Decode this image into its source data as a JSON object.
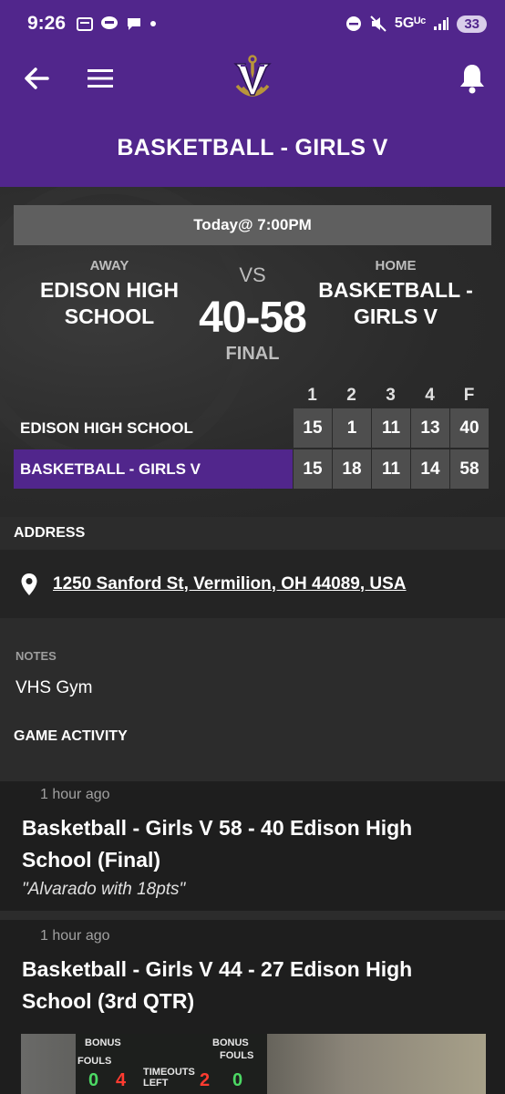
{
  "status_bar": {
    "time": "9:26",
    "network": "5Gᵁᶜ",
    "battery": "33"
  },
  "app_bar": {
    "title": "BASKETBALL - GIRLS V"
  },
  "game": {
    "date_time": "Today@ 7:00PM",
    "away": {
      "side_label": "AWAY",
      "team": "EDISON HIGH SCHOOL"
    },
    "home": {
      "side_label": "HOME",
      "team": "BASKETBALL - GIRLS V"
    },
    "vs": "VS",
    "score": "40-58",
    "status": "FINAL",
    "linescore": {
      "headers": [
        "1",
        "2",
        "3",
        "4",
        "F"
      ],
      "rows": [
        {
          "team": "EDISON HIGH SCHOOL",
          "scores": [
            "15",
            "1",
            "11",
            "13",
            "40"
          ]
        },
        {
          "team": "BASKETBALL - GIRLS V",
          "scores": [
            "15",
            "18",
            "11",
            "14",
            "58"
          ]
        }
      ]
    }
  },
  "address": {
    "header": "ADDRESS",
    "text": "1250 Sanford St, Vermilion, OH 44089, USA"
  },
  "notes": {
    "label": "NOTES",
    "value": "VHS Gym"
  },
  "activity": {
    "header": "GAME ACTIVITY",
    "items": [
      {
        "time": "1 hour ago",
        "title": "Basketball - Girls V 58 - 40 Edison High School (Final)",
        "quote": "\"Alvarado with 18pts\""
      },
      {
        "time": "1 hour ago",
        "title": "Basketball - Girls V 44 - 27 Edison High School (3rd QTR)"
      }
    ]
  },
  "photo_board": {
    "bonus_left": "BONUS",
    "bonus_right": "BONUS",
    "fouls_left": "FOULS",
    "fouls_right": "FOULS",
    "timeouts": "TIMEOUTS LEFT",
    "digits": [
      "0",
      "4",
      "2",
      "0"
    ]
  },
  "icons": {
    "back": "arrow-left-icon",
    "menu": "hamburger-icon",
    "notifications": "bell-icon",
    "location": "map-pin-icon"
  },
  "colors": {
    "brand_purple": "#51268c",
    "logo_gold": "#b8953a"
  }
}
